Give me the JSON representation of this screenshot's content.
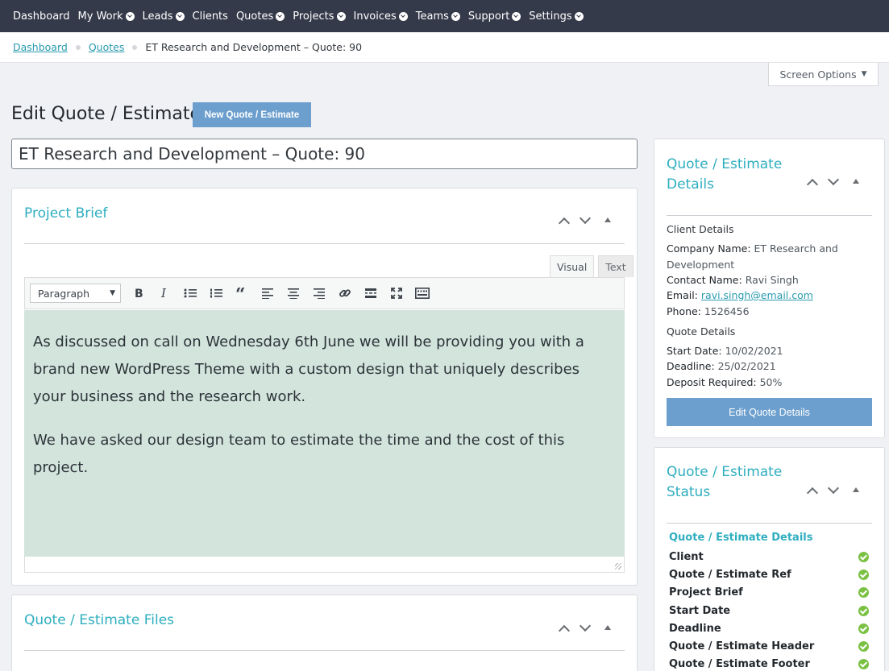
{
  "nav": [
    {
      "label": "Dashboard",
      "dropdown": false
    },
    {
      "label": "My Work",
      "dropdown": true
    },
    {
      "label": "Leads",
      "dropdown": true
    },
    {
      "label": "Clients",
      "dropdown": false
    },
    {
      "label": "Quotes",
      "dropdown": true
    },
    {
      "label": "Projects",
      "dropdown": true
    },
    {
      "label": "Invoices",
      "dropdown": true
    },
    {
      "label": "Teams",
      "dropdown": true
    },
    {
      "label": "Support",
      "dropdown": true
    },
    {
      "label": "Settings",
      "dropdown": true
    }
  ],
  "breadcrumb": {
    "items": [
      "Dashboard",
      "Quotes"
    ],
    "current": "ET Research and Development – Quote: 90"
  },
  "screen_options": {
    "label": "Screen Options",
    "arrow": "▼"
  },
  "page": {
    "title": "Edit Quote / Estimate",
    "new_button": "New Quote / Estimate",
    "quote_title_value": "ET Research and Development – Quote: 90"
  },
  "project_brief": {
    "title": "Project Brief",
    "tabs": {
      "visual": "Visual",
      "text": "Text"
    },
    "format_select": "Paragraph",
    "toolbar_icons": [
      "bold-icon",
      "italic-icon",
      "bullet-list-icon",
      "numbered-list-icon",
      "blockquote-icon",
      "align-left-icon",
      "align-center-icon",
      "align-right-icon",
      "link-icon",
      "read-more-icon",
      "fullscreen-icon",
      "toolbar-toggle-icon"
    ],
    "paragraphs": [
      "As discussed on call on Wednesday 6th June we will be providing you with a brand new WordPress Theme with a custom design that uniquely describes your business and the research work.",
      "We have asked our design team to estimate the time and the cost of this project."
    ]
  },
  "files_box": {
    "title": "Quote / Estimate Files"
  },
  "details_box": {
    "title": "Quote / Estimate Details",
    "client_heading": "Client Details",
    "company_label": "Company Name:",
    "company_value": "ET Research and Development",
    "contact_label": "Contact Name:",
    "contact_value": "Ravi Singh",
    "email_label": "Email:",
    "email_value": "ravi.singh@email.com",
    "phone_label": "Phone:",
    "phone_value": "1526456",
    "quote_heading": "Quote Details",
    "start_label": "Start Date:",
    "start_value": "10/02/2021",
    "deadline_label": "Deadline:",
    "deadline_value": "25/02/2021",
    "deposit_label": "Deposit Required:",
    "deposit_value": "50%",
    "edit_button": "Edit Quote Details"
  },
  "status_box": {
    "title": "Quote / Estimate Status",
    "section_link": "Quote / Estimate Details",
    "items": [
      {
        "label": "Client",
        "status": "complete"
      },
      {
        "label": "Quote / Estimate Ref",
        "status": "complete"
      },
      {
        "label": "Project Brief",
        "status": "complete"
      },
      {
        "label": "Start Date",
        "status": "complete"
      },
      {
        "label": "Deadline",
        "status": "complete"
      },
      {
        "label": "Quote / Estimate Header",
        "status": "complete"
      },
      {
        "label": "Quote / Estimate Footer",
        "status": "complete"
      }
    ]
  },
  "colors": {
    "nav_bg": "#353a4a",
    "accent": "#2eaebf",
    "button": "#6c9fce",
    "editor_bg": "#d3e4dd",
    "check": "#7ac143"
  }
}
